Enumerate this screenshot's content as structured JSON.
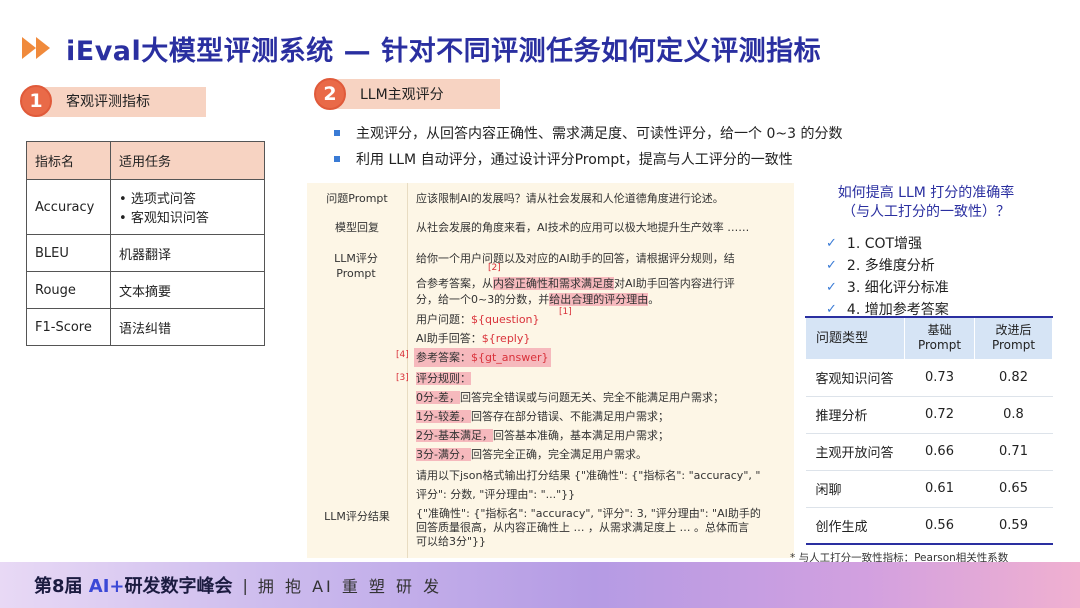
{
  "title": "iEval大模型评测系统 — 针对不同评测任务如何定义评测指标",
  "section1": {
    "num": "1",
    "label": "客观评测指标"
  },
  "section2": {
    "num": "2",
    "label": "LLM主观评分"
  },
  "metrics_table": {
    "headers": [
      "指标名",
      "适用任务"
    ],
    "rows": [
      {
        "name": "Accuracy",
        "tasks": [
          "选项式问答",
          "客观知识问答"
        ]
      },
      {
        "name": "BLEU",
        "tasks": [
          "机器翻译"
        ]
      },
      {
        "name": "Rouge",
        "tasks": [
          "文本摘要"
        ]
      },
      {
        "name": "F1-Score",
        "tasks": [
          "语法纠错"
        ]
      }
    ]
  },
  "bullets": [
    "主观评分，从回答内容正确性、需求满足度、可读性评分，给一个 0~3 的分数",
    "利用 LLM 自动评分，通过设计评分Prompt，提高与人工评分的一致性"
  ],
  "prompt_example": {
    "question_label": "问题Prompt",
    "question": "应该限制AI的发展吗？请从社会发展和人伦道德角度进行论述。",
    "reply_label": "模型回复",
    "reply": "从社会发展的角度来看，AI技术的应用可以极大地提升生产效率 ……",
    "llm_label": "LLM评分Prompt",
    "llm_line1": "给你一个用户问题以及对应的AI助手的回答，请根据评分规则，结",
    "llm_line2a": "合参考答案，从",
    "llm_line2b": "内容正确性和需求满足度",
    "llm_line2c": "对AI助手回答内容进行评",
    "llm_line3a": "分，给一个0~3的分数，并",
    "llm_line3b": "给出合理的评分理由",
    "llm_line3c": "。",
    "user_q_label": "用户问题：",
    "user_q_var": "${question}",
    "ai_reply_label": "AI助手回答：",
    "ai_reply_var": "${reply}",
    "ref_label": "参考答案：",
    "ref_var": "${gt_answer}",
    "rules_label": "评分规则：",
    "rule0a": "0分-差，",
    "rule0b": "回答完全错误或与问题无关、完全不能满足用户需求；",
    "rule1a": "1分-较差，",
    "rule1b": "回答存在部分错误、不能满足用户需求；",
    "rule2a": "2分-基本满足，",
    "rule2b": "回答基本准确，基本满足用户需求；",
    "rule3a": "3分-满分，",
    "rule3b": "回答完全正确，完全满足用户需求。",
    "json_line1": "请用以下json格式输出打分结果 {\"准确性\": {\"指标名\": \"accuracy\", \"",
    "json_line2": "评分\": 分数, \"评分理由\": \"...\"}}",
    "result_label": "LLM评分结果",
    "result_line1": "{\"准确性\": {\"指标名\": \"accuracy\", \"评分\": 3, \"评分理由\": \"AI助手的",
    "result_line2": "回答质量很高，从内容正确性上 … ，从需求满足度上 … 。总体而言",
    "result_line3": "可以给3分\"}}",
    "tag1": "[1]",
    "tag2": "[2]",
    "tag3": "[3]",
    "tag4": "[4]"
  },
  "improve": {
    "title_line1": "如何提高 LLM 打分的准确率",
    "title_line2": "（与人工打分的一致性）？",
    "items": [
      "1. COT增强",
      "2. 多维度分析",
      "3. 细化评分标准",
      "4. 增加参考答案"
    ]
  },
  "results_table": {
    "headers": [
      "问题类型",
      "基础\nPrompt",
      "改进后\nPrompt"
    ],
    "rows": [
      {
        "type": "客观知识问答",
        "base": "0.73",
        "improved": "0.82"
      },
      {
        "type": "推理分析",
        "base": "0.72",
        "improved": "0.8"
      },
      {
        "type": "主观开放问答",
        "base": "0.66",
        "improved": "0.71"
      },
      {
        "type": "闲聊",
        "base": "0.61",
        "improved": "0.65"
      },
      {
        "type": "创作生成",
        "base": "0.56",
        "improved": "0.59"
      }
    ]
  },
  "footnote": "* 与人工打分一致性指标：Pearson相关性系数",
  "footer": {
    "main_a": "第8届 ",
    "main_ai": "AI+",
    "main_b": "研发数字峰会",
    "sep": "|",
    "slogan": "拥 抱 AI  重 塑 研 发"
  },
  "colors": {
    "title": "#2a2fa0",
    "accent": "#e96a48",
    "highlight": "#f6b9bd",
    "variable": "#d9313a"
  }
}
